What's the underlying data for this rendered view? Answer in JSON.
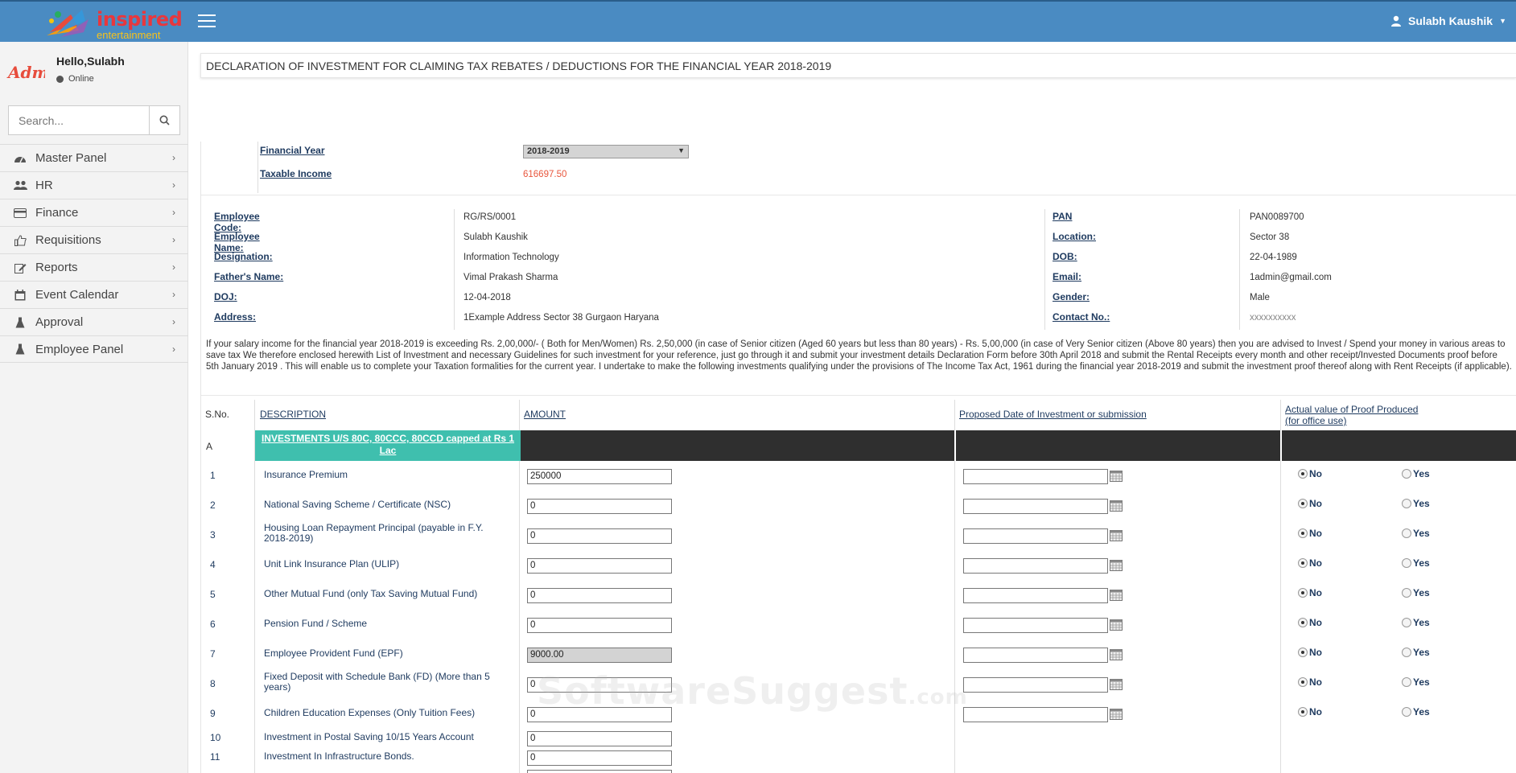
{
  "header": {
    "brand_line1": "inspired",
    "brand_line2": "entertainment",
    "user_name": "Sulabh Kaushik"
  },
  "sidebar": {
    "avatar_text": "Admin",
    "hello": "Hello,Sulabh",
    "status": "Online",
    "search_placeholder": "Search...",
    "items": [
      {
        "label": "Master Panel",
        "icon": "dashboard-icon"
      },
      {
        "label": "HR",
        "icon": "users-icon"
      },
      {
        "label": "Finance",
        "icon": "credit-card-icon"
      },
      {
        "label": "Requisitions",
        "icon": "thumbs-up-icon"
      },
      {
        "label": "Reports",
        "icon": "edit-icon"
      },
      {
        "label": "Event Calendar",
        "icon": "calendar-icon"
      },
      {
        "label": "Approval",
        "icon": "flask-icon"
      },
      {
        "label": "Employee Panel",
        "icon": "flask-icon"
      }
    ]
  },
  "page": {
    "title": "DECLARATION OF INVESTMENT FOR CLAIMING TAX REBATES / DEDUCTIONS FOR THE FINANCIAL YEAR 2018-2019"
  },
  "summary": {
    "fy_label": "Financial Year",
    "fy_value": "2018-2019",
    "taxable_label": "Taxable Income",
    "taxable_value": "616697.50"
  },
  "employee": {
    "left": [
      {
        "label": "Employee Code:",
        "value": "RG/RS/0001"
      },
      {
        "label": "Employee Name:",
        "value": "Sulabh Kaushik"
      },
      {
        "label": "Designation:",
        "value": "Information Technology"
      },
      {
        "label": "Father's Name:",
        "value": "Vimal Prakash Sharma"
      },
      {
        "label": "DOJ:",
        "value": "12-04-2018"
      },
      {
        "label": "Address:",
        "value": "1Example Address Sector 38 Gurgaon Haryana"
      }
    ],
    "right": [
      {
        "label": "PAN",
        "value": "PAN0089700"
      },
      {
        "label": "Location:",
        "value": "Sector 38"
      },
      {
        "label": "DOB:",
        "value": "22-04-1989"
      },
      {
        "label": "Email:",
        "value": "1admin@gmail.com"
      },
      {
        "label": "Gender:",
        "value": "Male"
      },
      {
        "label": "Contact No.:",
        "value": "xxxxxxxxxx"
      }
    ]
  },
  "instructions": "If your salary income for the financial year 2018-2019 is exceeding Rs. 2,00,000/- ( Both for Men/Women) Rs. 2,50,000 (in case of Senior citizen (Aged 60 years but less than 80 years) - Rs. 5,00,000 (in case of Very Senior citizen (Above 80 years) then you are advised to Invest / Spend your money in various areas to save tax We therefore enclosed herewith List of Investment and necessary Guidelines for such investment for your reference, just go through it and submit your investment details Declaration Form before 30th April 2018 and submit the Rental Receipts every month and other receipt/Invested Documents proof before 5th January 2019 . This will enable us to complete your Taxation formalities for the current year. I undertake to make the following investments qualifying under the provisions of The Income Tax Act, 1961 during the financial year 2018-2019 and submit the investment proof thereof along with Rent Receipts (if applicable).",
  "table": {
    "headers": {
      "sno": "S.No.",
      "description": "DESCRIPTION",
      "amount": "AMOUNT",
      "proposed_date": "Proposed Date of Investment or submission",
      "actual_value_1": "Actual value of Proof Produced",
      "actual_value_2": "(for office use)"
    },
    "section": {
      "code": "A",
      "title": "INVESTMENTS U/S 80C, 80CCC, 80CCD capped at Rs 1 Lac"
    },
    "no_label": "No",
    "yes_label": "Yes",
    "rows": [
      {
        "sno": "1",
        "desc": "Insurance Premium",
        "amount": "250000"
      },
      {
        "sno": "2",
        "desc": "National Saving Scheme / Certificate (NSC)",
        "amount": "0"
      },
      {
        "sno": "3",
        "desc": "Housing Loan Repayment Principal (payable in F.Y. 2018-2019)",
        "amount": "0"
      },
      {
        "sno": "4",
        "desc": "Unit Link Insurance Plan (ULIP)",
        "amount": "0"
      },
      {
        "sno": "5",
        "desc": "Other Mutual Fund (only Tax Saving Mutual Fund)",
        "amount": "0"
      },
      {
        "sno": "6",
        "desc": "Pension Fund / Scheme",
        "amount": "0"
      },
      {
        "sno": "7",
        "desc": "Employee Provident Fund (EPF)",
        "amount": "9000.00"
      },
      {
        "sno": "8",
        "desc": "Fixed Deposit with Schedule Bank (FD) (More than 5 years)",
        "amount": "0"
      },
      {
        "sno": "9",
        "desc": "Children Education Expenses (Only Tuition Fees)",
        "amount": "0"
      },
      {
        "sno": "10",
        "desc": "Investment in Postal Saving 10/15 Years Account",
        "amount": "0"
      },
      {
        "sno": "11",
        "desc": "Investment In Infrastructure Bonds.",
        "amount": "0"
      }
    ]
  },
  "watermark": {
    "main": "SoftwareSuggest",
    "suffix": ".com"
  },
  "colors": {
    "header": "#4a8bc2",
    "teal": "#3fbfae",
    "dark_band": "#2f2f2f",
    "taxable": "#e8563c"
  }
}
